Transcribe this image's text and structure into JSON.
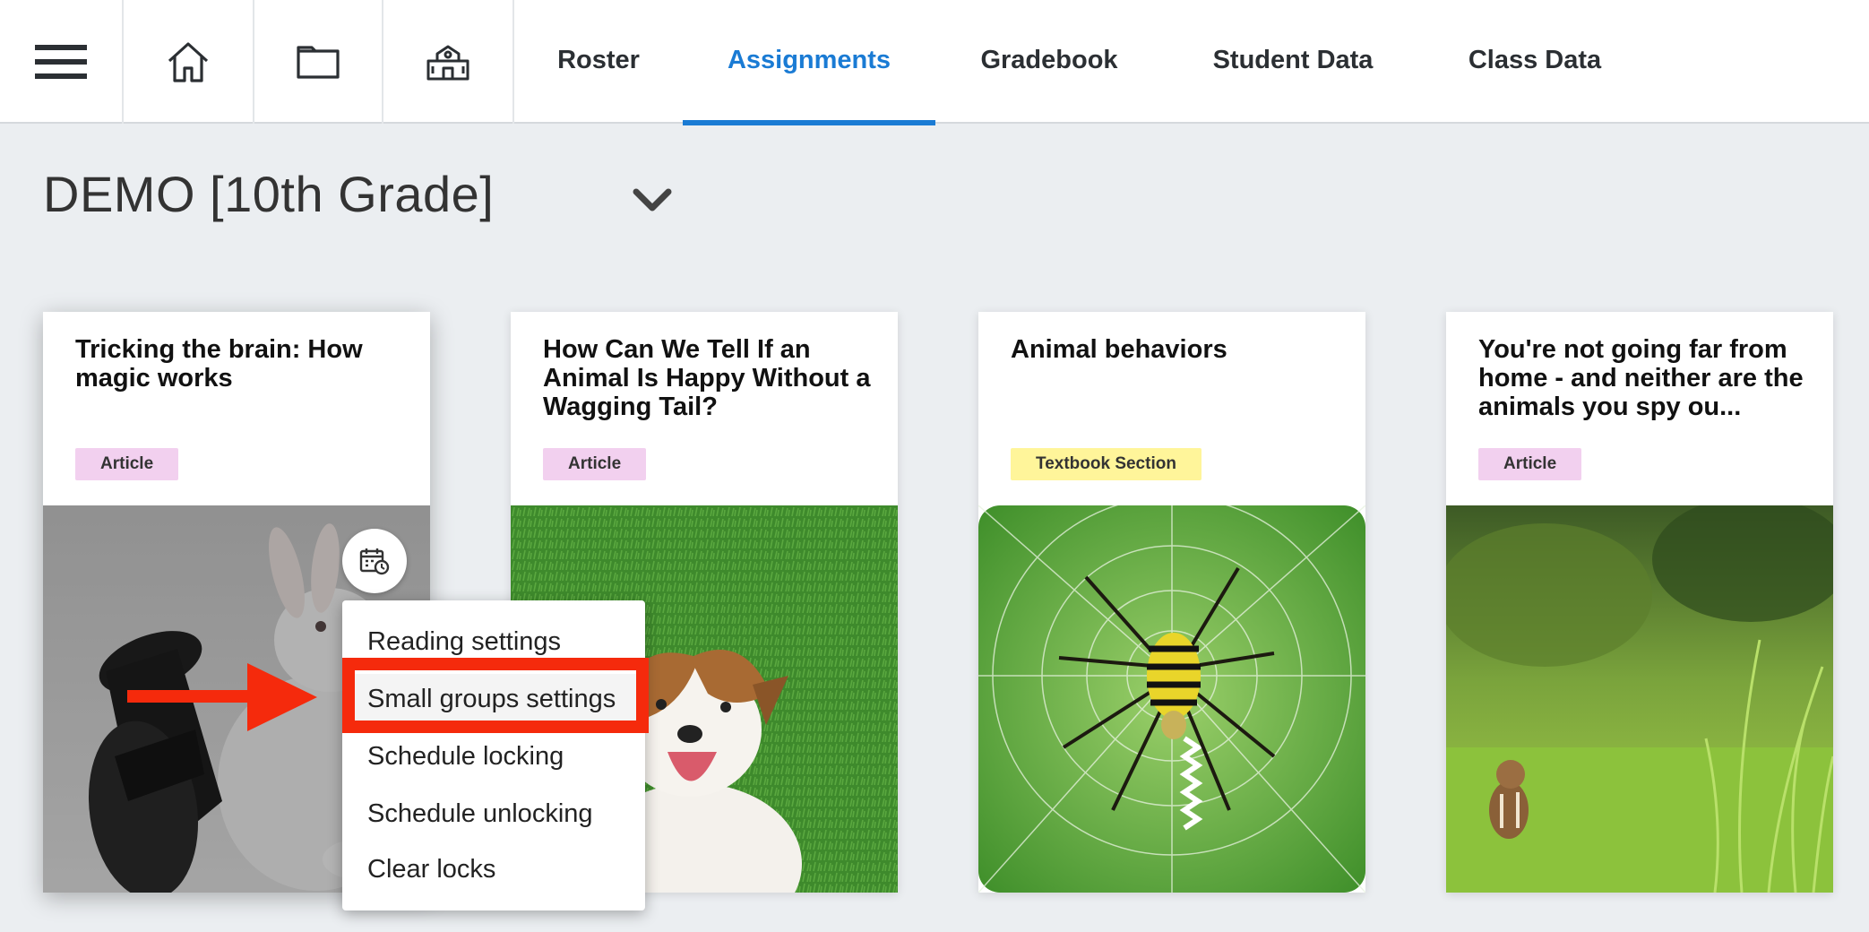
{
  "nav": {
    "icons": [
      "hamburger-menu-icon",
      "home-icon",
      "book-icon",
      "school-icon"
    ],
    "tabs": [
      {
        "label": "Roster",
        "active": false
      },
      {
        "label": "Assignments",
        "active": true
      },
      {
        "label": "Gradebook",
        "active": false
      },
      {
        "label": "Student Data",
        "active": false
      },
      {
        "label": "Class Data",
        "active": false
      }
    ],
    "accent_color": "#1a7bd4"
  },
  "class_selector": {
    "title": "DEMO [10th Grade]",
    "icon": "chevron-down-icon"
  },
  "cards": [
    {
      "title": "Tricking the brain: How magic works",
      "type": "Article",
      "image": "rabbit-in-top-hat"
    },
    {
      "title": "How Can We Tell If an Animal Is Happy Without a Wagging Tail?",
      "type": "Article",
      "image": "happy-dog-on-grass"
    },
    {
      "title": "Animal behaviors",
      "type": "Textbook Section",
      "image": "spider-in-web"
    },
    {
      "title": "You're not going far from home - and neither are the animals you spy ou...",
      "type": "Article",
      "image": "chipmunk-in-grass"
    }
  ],
  "badge_colors": {
    "Article": "#f2d0ef",
    "Textbook Section": "#fff59a"
  },
  "card_menu": {
    "trigger_icon": "calendar-clock-icon",
    "items": [
      {
        "label": "Reading settings"
      },
      {
        "label": "Small groups settings",
        "highlighted": true
      },
      {
        "label": "Schedule locking"
      },
      {
        "label": "Schedule unlocking"
      },
      {
        "label": "Clear locks"
      }
    ]
  },
  "annotation": {
    "arrow_icon": "red-arrow-icon",
    "highlight_color": "#f52a0c"
  }
}
